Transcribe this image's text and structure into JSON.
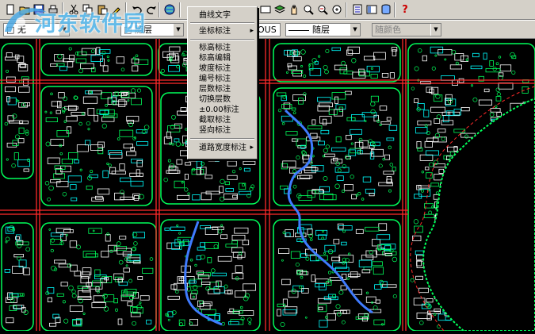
{
  "watermark": {
    "text": "河东软件园"
  },
  "toolbar": {
    "top_icons": [
      "new-icon",
      "open-icon",
      "save-icon",
      "print-icon",
      "preview-icon",
      "cut-icon",
      "copy-icon",
      "paste-icon",
      "match-props-icon",
      "undo-icon",
      "redo-icon",
      "globe-icon",
      "pan-icon",
      "zoom-icon",
      "named-views-icon",
      "layer-icon",
      "zoom-window-icon",
      "zoom-previous-icon",
      "zoom-in-icon",
      "zoom-all-icon",
      "properties-icon",
      "design-center-icon",
      "database-icon",
      "help-icon"
    ],
    "layer_combo": "□ 无",
    "layer_combo2": "□ 随层",
    "linetype_combo": "BYLAYER",
    "linetype_partial": "OUS",
    "lineweight_combo": "随层",
    "color_combo": "随颜色"
  },
  "context_menu": {
    "items": [
      {
        "label": "曲线文字",
        "submenu": false
      },
      {
        "label": "坐标标注",
        "submenu": true
      },
      {
        "label": "标高标注",
        "submenu": false
      },
      {
        "label": "标高编辑",
        "submenu": false
      },
      {
        "label": "坡度标注",
        "submenu": false
      },
      {
        "label": "编号标注",
        "submenu": false
      },
      {
        "label": "层数标注",
        "submenu": false
      },
      {
        "label": "切换层数",
        "submenu": false
      },
      {
        "label": "±0.00标注",
        "submenu": false
      },
      {
        "label": "截取标注",
        "submenu": false
      },
      {
        "label": "竖向标注",
        "submenu": false
      },
      {
        "label": "道路宽度标注",
        "submenu": true
      }
    ]
  },
  "colors": {
    "road": "#ff2a2a",
    "block": "#00ff5a",
    "building": "#ffffff",
    "water": "#3f7bff",
    "tree": "#00ffff",
    "lake": "#000000",
    "menu_bg": "#d4d0c8"
  }
}
